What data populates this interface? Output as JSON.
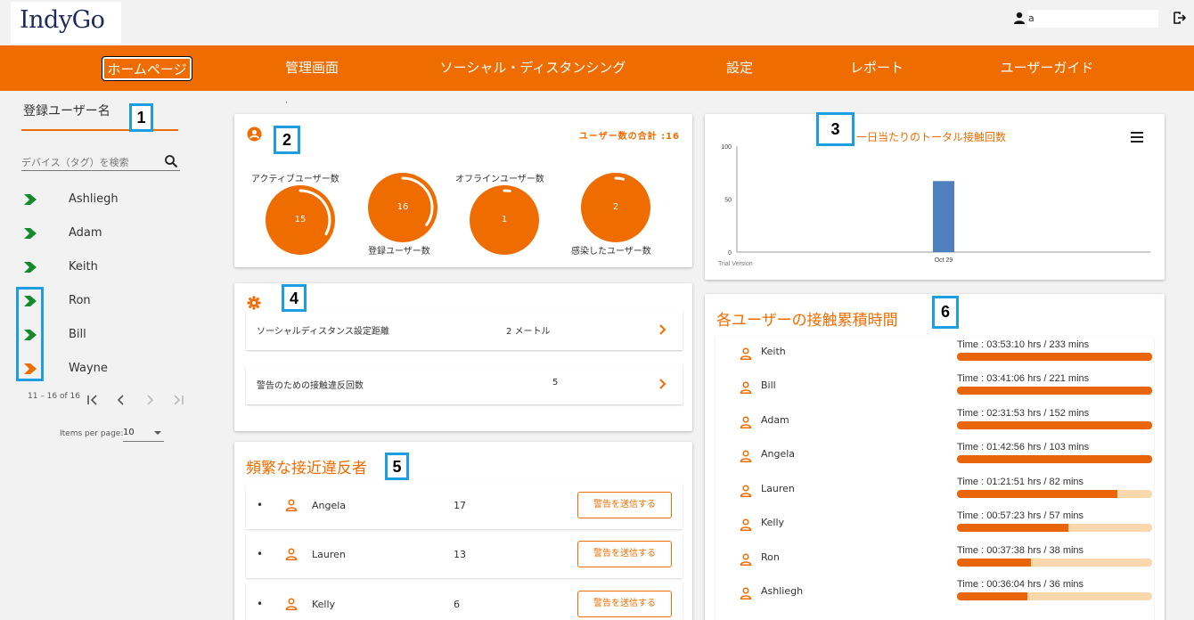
{
  "colors": {
    "accent": "#ef6c00",
    "active_device": "#138a2e",
    "inactive_device": "#ef6c00",
    "bar_fill": "#e8650a",
    "bar_track": "#fbd7ad",
    "chart_bar": "#4f7fbf"
  },
  "header": {
    "logo": "IndyGo",
    "user_name": "a",
    "user_icon": "person-icon",
    "logout_icon": "logout-icon"
  },
  "nav": {
    "items": [
      {
        "label": "ホームページ",
        "active": true
      },
      {
        "label": "管理画面"
      },
      {
        "label": "ソーシャル・ディスタンシング"
      },
      {
        "label": "設定"
      },
      {
        "label": "レポート"
      },
      {
        "label": "ユーザーガイド"
      }
    ]
  },
  "callouts": [
    "1",
    "2",
    "3",
    "4",
    "5",
    "6"
  ],
  "left": {
    "title": "登録ユーザー名",
    "search_placeholder": "デバイス（タグ）を検索",
    "devices": [
      {
        "name": "Ashliegh",
        "status": "active"
      },
      {
        "name": "Adam",
        "status": "active"
      },
      {
        "name": "Keith",
        "status": "active"
      },
      {
        "name": "Ron",
        "status": "active"
      },
      {
        "name": "Bill",
        "status": "active"
      },
      {
        "name": "Wayne",
        "status": "inactive"
      }
    ],
    "pager_text": "11 – 16 of 16",
    "items_per_page_label": "Items per page:",
    "items_per_page_value": "10"
  },
  "stats": {
    "dot": "·",
    "total_label": "ユーザー数の合計 :16",
    "circles": [
      {
        "label": "アクティブユーザー数",
        "value": "15",
        "fraction": 0.94
      },
      {
        "label": "登録ユーザー数",
        "value": "16",
        "fraction": 1.0
      },
      {
        "label": "オフラインユーザー数",
        "value": "1",
        "fraction": 0.06
      },
      {
        "label": "感染したユーザー数",
        "value": "2",
        "fraction": 0.12
      }
    ]
  },
  "settings": {
    "rows": [
      {
        "label": "ソーシャルディスタンス設定距離",
        "value": "2 メートル"
      },
      {
        "label": "警告のための接触違反回数",
        "value": "5"
      }
    ]
  },
  "violators": {
    "title": "頻繁な接近違反者",
    "button_label": "警告を送信する",
    "rows": [
      {
        "name": "Angela",
        "count": "17"
      },
      {
        "name": "Lauren",
        "count": "13"
      },
      {
        "name": "Kelly",
        "count": "6"
      }
    ]
  },
  "chart_data": {
    "type": "bar",
    "title": "一日当たりのトータル接触回数",
    "categories": [
      "Oct 29"
    ],
    "values": [
      67
    ],
    "ylim": [
      0,
      100
    ],
    "yticks": [
      "100",
      "50",
      "0"
    ],
    "footer": "Trial Version",
    "grid": false
  },
  "contact_time": {
    "title": "各ユーザーの接触累積時間",
    "rows": [
      {
        "name": "Keith",
        "time": "Time : 03:53:10 hrs / 233 mins",
        "fraction": 1.0
      },
      {
        "name": "Bill",
        "time": "Time : 03:41:06 hrs / 221 mins",
        "fraction": 1.0
      },
      {
        "name": "Adam",
        "time": "Time : 02:31:53 hrs / 152 mins",
        "fraction": 1.0
      },
      {
        "name": "Angela",
        "time": "Time : 01:42:56 hrs / 103 mins",
        "fraction": 1.0
      },
      {
        "name": "Lauren",
        "time": "Time : 01:21:51 hrs / 82 mins",
        "fraction": 0.82
      },
      {
        "name": "Kelly",
        "time": "Time : 00:57:23 hrs / 57 mins",
        "fraction": 0.57
      },
      {
        "name": "Ron",
        "time": "Time : 00:37:38 hrs / 38 mins",
        "fraction": 0.38
      },
      {
        "name": "Ashliegh",
        "time": "Time : 00:36:04 hrs / 36 mins",
        "fraction": 0.36
      }
    ]
  }
}
